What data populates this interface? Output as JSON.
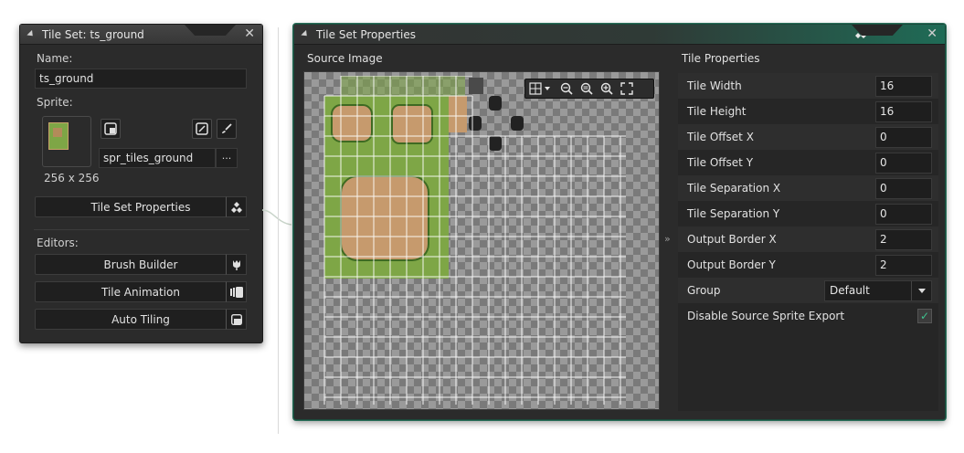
{
  "left_panel": {
    "title": "Tile Set: ts_ground",
    "name_label": "Name:",
    "name_value": "ts_ground",
    "sprite_label": "Sprite:",
    "sprite_name": "spr_tiles_ground",
    "sprite_size": "256 x 256",
    "more_label": "···",
    "tileset_props_button": "Tile Set Properties",
    "editors_label": "Editors:",
    "brush_builder": "Brush Builder",
    "tile_animation": "Tile Animation",
    "auto_tiling": "Auto Tiling",
    "close_glyph": "✕"
  },
  "right_panel": {
    "title": "Tile Set Properties",
    "close_glyph": "✕",
    "source_image_label": "Source Image",
    "tile_properties_label": "Tile Properties",
    "splitter_glyph": "»",
    "properties": [
      {
        "name": "Tile Width",
        "value": "16"
      },
      {
        "name": "Tile Height",
        "value": "16"
      },
      {
        "name": "Tile Offset X",
        "value": "0"
      },
      {
        "name": "Tile Offset Y",
        "value": "0"
      },
      {
        "name": "Tile Separation X",
        "value": "0"
      },
      {
        "name": "Tile Separation Y",
        "value": "0"
      },
      {
        "name": "Output Border X",
        "value": "2"
      },
      {
        "name": "Output Border Y",
        "value": "2"
      }
    ],
    "group_label": "Group",
    "group_value": "Default",
    "disable_export_label": "Disable Source Sprite Export",
    "disable_export_checked": true,
    "check_glyph": "✓"
  },
  "colors": {
    "accent": "#1f6b56",
    "check": "#3ec28f",
    "grass": "#7ea646",
    "dirt": "#c69a6d"
  },
  "icons": [
    "close-icon",
    "diamond-icon",
    "grid-icon",
    "zoom-out-icon",
    "zoom-reset-icon",
    "zoom-in-icon",
    "fullscreen-icon",
    "new-sprite-icon",
    "edit-sprite-icon",
    "brush-icon",
    "flower-icon",
    "animation-icon",
    "autotile-icon",
    "check-icon",
    "chevron-down-icon"
  ]
}
